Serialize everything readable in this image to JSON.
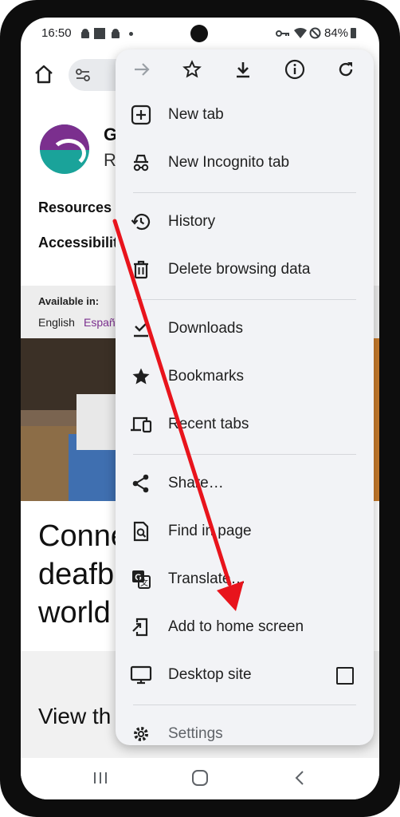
{
  "status_bar": {
    "time": "16:50",
    "battery": "84%"
  },
  "page": {
    "org_initial": "G",
    "org_second_line": "R",
    "nav_links": [
      "Resources",
      "Accessibilit"
    ],
    "available_in_label": "Available in:",
    "languages": [
      "English",
      "Españ"
    ],
    "headline_lines": [
      "Conne",
      "deafb",
      "world"
    ],
    "view_text": "View th"
  },
  "menu": {
    "items": [
      {
        "label": "New tab",
        "icon": "plus-box-icon"
      },
      {
        "label": "New Incognito tab",
        "icon": "incognito-icon"
      },
      {
        "label": "History",
        "icon": "history-icon"
      },
      {
        "label": "Delete browsing data",
        "icon": "trash-icon"
      },
      {
        "label": "Downloads",
        "icon": "download-check-icon"
      },
      {
        "label": "Bookmarks",
        "icon": "star-filled-icon"
      },
      {
        "label": "Recent tabs",
        "icon": "devices-icon"
      },
      {
        "label": "Share…",
        "icon": "share-icon"
      },
      {
        "label": "Find in page",
        "icon": "find-in-page-icon"
      },
      {
        "label": "Translate…",
        "icon": "translate-icon"
      },
      {
        "label": "Add to home screen",
        "icon": "add-to-home-icon"
      },
      {
        "label": "Desktop site",
        "icon": "monitor-icon"
      },
      {
        "label": "Settings",
        "icon": "gear-icon"
      }
    ],
    "desktop_site_checked": false
  },
  "colors": {
    "menu_bg": "#f2f3f6",
    "arrow": "#e8141c",
    "logo_purple": "#7b2f8e",
    "logo_teal": "#1aa39a"
  }
}
